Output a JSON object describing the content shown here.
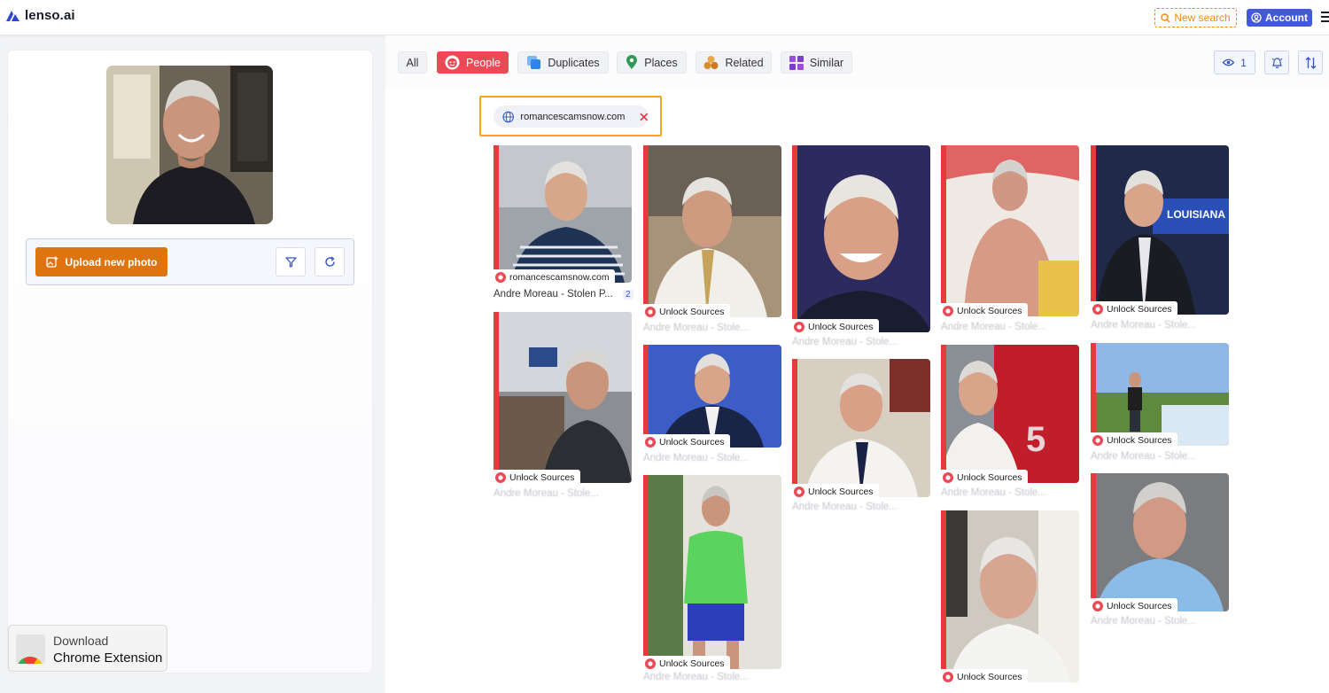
{
  "header": {
    "logo_text": "lenso.ai",
    "new_search_label": "New search",
    "account_label": "Account"
  },
  "left_panel": {
    "upload_label": "Upload new photo",
    "chrome_ext": {
      "line1": "Download",
      "line2": "Chrome Extension"
    }
  },
  "tabs": [
    {
      "label": "All",
      "icon": "none"
    },
    {
      "label": "People",
      "icon": "face-icon"
    },
    {
      "label": "Duplicates",
      "icon": "duplicate-icon"
    },
    {
      "label": "Places",
      "icon": "pin-icon"
    },
    {
      "label": "Related",
      "icon": "related-icon"
    },
    {
      "label": "Similar",
      "icon": "grid-icon"
    }
  ],
  "toolbar": {
    "view_count": "1"
  },
  "domain_filter": {
    "domain": "romancescamsnow.com"
  },
  "results": {
    "first": {
      "source": "romancescamsnow.com",
      "title": "Andre Moreau - Stolen P...",
      "count": "2"
    },
    "locked_label": "Unlock Sources",
    "locked_caption": "Andre Moreau - Stole..."
  },
  "colors": {
    "accent_red": "#ec4956",
    "upload_orange": "#de7410",
    "account_blue": "#4359d8",
    "new_search_orange": "#f08a16",
    "highlight_yellow": "#f4a51a"
  }
}
